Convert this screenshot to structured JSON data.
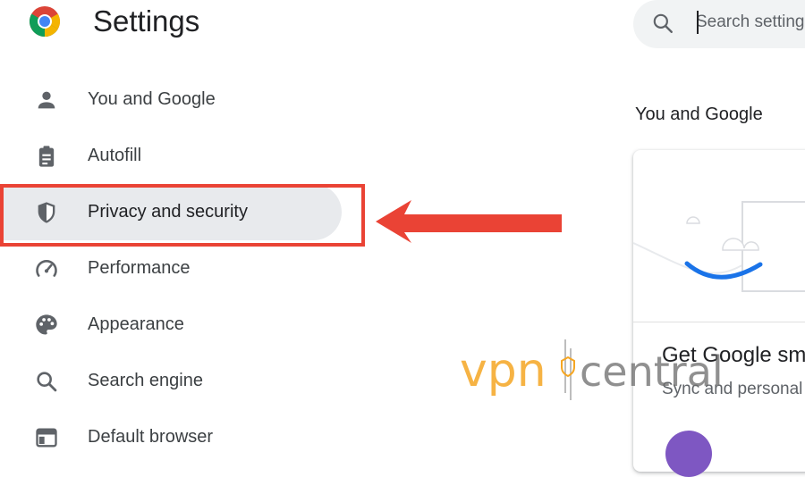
{
  "header": {
    "title": "Settings",
    "logo_icon": "chrome-logo-icon"
  },
  "search": {
    "placeholder": "Search settings",
    "icon": "search-icon"
  },
  "sidebar": {
    "items": [
      {
        "label": "You and Google",
        "icon": "person-icon"
      },
      {
        "label": "Autofill",
        "icon": "clipboard-icon"
      },
      {
        "label": "Privacy and security",
        "icon": "shield-icon",
        "active": true
      },
      {
        "label": "Performance",
        "icon": "speedometer-icon"
      },
      {
        "label": "Appearance",
        "icon": "palette-icon"
      },
      {
        "label": "Search engine",
        "icon": "search-icon"
      },
      {
        "label": "Default browser",
        "icon": "browser-window-icon"
      }
    ]
  },
  "main": {
    "section_title": "You and Google",
    "card": {
      "title": "Get Google sm",
      "subtitle": "Sync and personal"
    }
  },
  "annotation": {
    "highlight_color": "#ea4335",
    "arrow_color": "#ea4335"
  },
  "watermark": {
    "brand_part1": "vpn",
    "brand_part2": "central",
    "colors": {
      "vpn": "#f5a623",
      "central": "#6b6b6b"
    }
  },
  "colors": {
    "active_item_bg": "#e8eaed",
    "accent_blue": "#1a73e8",
    "text_primary": "#202124",
    "text_secondary": "#5f6368"
  }
}
